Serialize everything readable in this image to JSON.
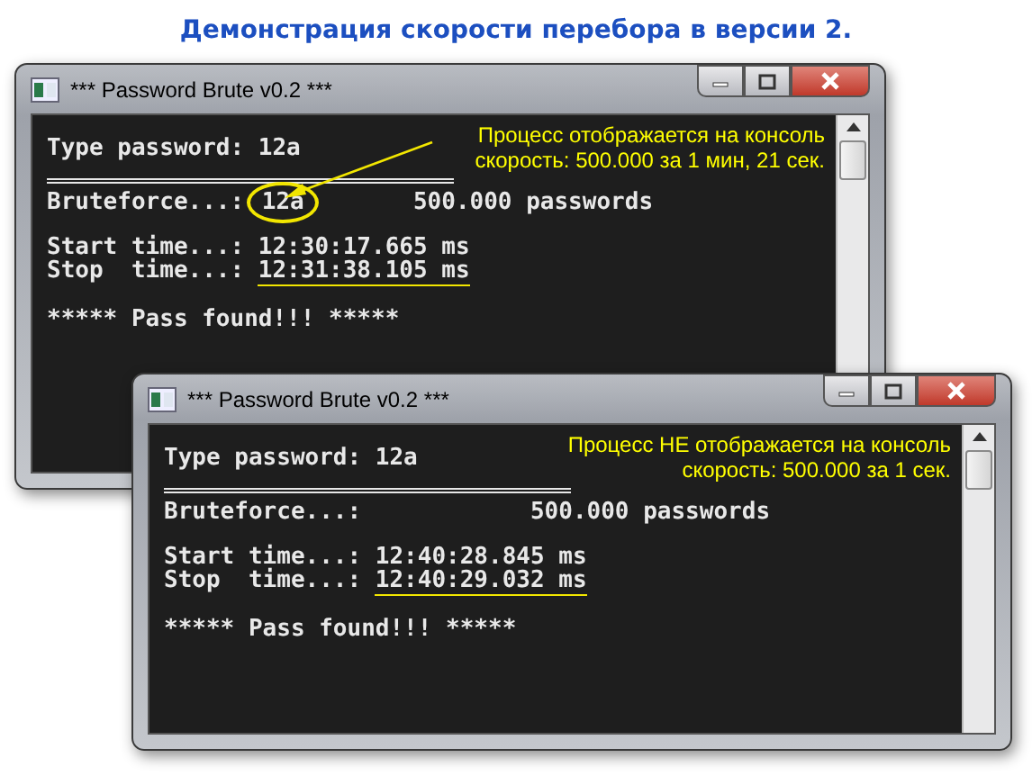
{
  "heading": "Демонстрация скорости перебора в версии 2.",
  "windows": [
    {
      "title": "*** Password Brute v0.2 ***",
      "note": [
        "Процесс отображается на консоль",
        "скорость: 500.000 за 1 мин, 21 сек."
      ],
      "type_line": "Type password: 12a",
      "brute_label": "Bruteforce...:",
      "brute_value": "12a",
      "brute_count": "500.000 passwords",
      "start_label": "Start time...:",
      "start_value": "12:30:17.665 ms",
      "stop_label": "Stop  time...:",
      "stop_value": "12:31:38.105 ms",
      "result": "***** Pass found!!! *****"
    },
    {
      "title": "*** Password Brute v0.2 ***",
      "note": [
        "Процесс НЕ отображается на консоль",
        "скорость: 500.000 за 1 сек."
      ],
      "type_line": "Type password: 12a",
      "brute_label": "Bruteforce...:",
      "brute_count": "500.000 passwords",
      "start_label": "Start time...:",
      "start_value": "12:40:28.845 ms",
      "stop_label": "Stop  time...:",
      "stop_value": "12:40:29.032 ms",
      "result": "***** Pass found!!! *****"
    }
  ]
}
